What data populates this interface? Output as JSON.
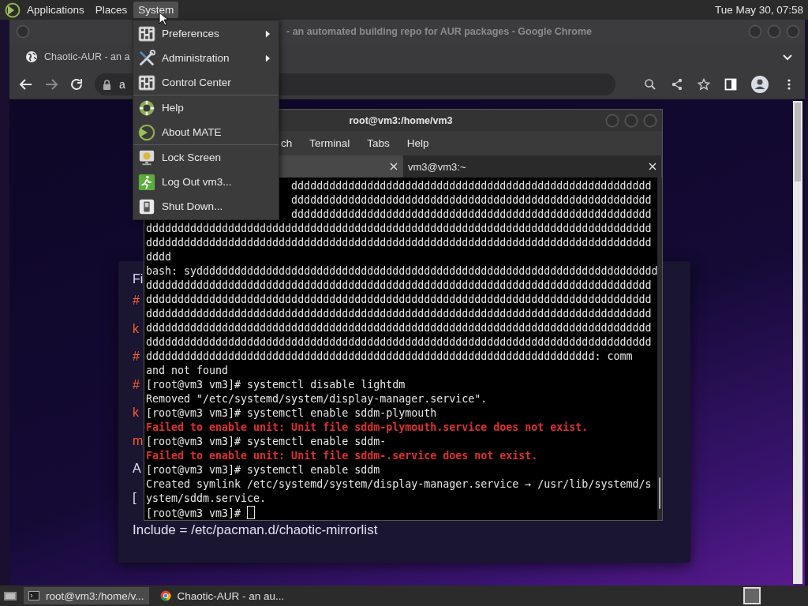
{
  "top_panel": {
    "menus": [
      {
        "label": "Applications",
        "selected": false
      },
      {
        "label": "Places",
        "selected": false
      },
      {
        "label": "System",
        "selected": true
      }
    ],
    "clock": "Tue May 30, 07:58"
  },
  "system_menu": {
    "items": [
      {
        "label": "Preferences",
        "kind": "preferences",
        "submenu": true,
        "separator_after": false
      },
      {
        "label": "Administration",
        "kind": "tools",
        "submenu": true,
        "separator_after": false
      },
      {
        "label": "Control Center",
        "kind": "preferences",
        "submenu": false,
        "separator_after": true
      },
      {
        "label": "Help",
        "kind": "help",
        "submenu": false,
        "separator_after": false
      },
      {
        "label": "About MATE",
        "kind": "about",
        "submenu": false,
        "separator_after": true
      },
      {
        "label": "Lock Screen",
        "kind": "lock",
        "submenu": false,
        "separator_after": false
      },
      {
        "label": "Log Out vm3...",
        "kind": "logout",
        "submenu": false,
        "separator_after": false
      },
      {
        "label": "Shut Down...",
        "kind": "shutdown",
        "submenu": false,
        "separator_after": false
      }
    ]
  },
  "browser": {
    "title": "- an automated building repo for AUR packages - Google Chrome",
    "tab": "Chaotic-AUR - an a",
    "address": "a",
    "page_fragments": [
      {
        "text": "Fi",
        "kind": "plain"
      },
      {
        "text": "#",
        "kind": "comment"
      },
      {
        "text": "k",
        "kind": "comment"
      },
      {
        "text": "#",
        "kind": "comment"
      },
      {
        "text": "#",
        "kind": "comment"
      },
      {
        "text": "k",
        "kind": "comment"
      },
      {
        "text": "m",
        "kind": "comment"
      },
      {
        "text": "A",
        "kind": "plain"
      },
      {
        "text": "[",
        "kind": "code"
      },
      {
        "text": "Include = /etc/pacman.d/chaotic-mirrorlist",
        "kind": "code"
      }
    ]
  },
  "terminal": {
    "title": "root@vm3:/home/vm3",
    "menus": [
      "ch",
      "Terminal",
      "Tabs",
      "Help"
    ],
    "tabs": [
      {
        "selected": true
      },
      {
        "label": "vm3@vm3:~",
        "selected": false
      }
    ],
    "lines": [
      {
        "kind": "covered",
        "text": "ddddddddddddddddddddddddddddddddddddddddddddddddddddddddd"
      },
      {
        "kind": "covered",
        "text": "ddddddddddddddddddddddddddddddddddddddddddddddddddddddddd"
      },
      {
        "kind": "covered",
        "text": "ddddddddddddddddddddddddddddddddddddddddddddddddddddddddd"
      },
      {
        "kind": "output",
        "text": "dddddddddddddddddddddddddddddddddddddddddddddddddddddddddddddddddddddddddddddddd"
      },
      {
        "kind": "output",
        "text": "dddddddddddddddddddddddddddddddddddddddddddddddddddddddddddddddddddddddddddddddd"
      },
      {
        "kind": "output",
        "text": "dddd"
      },
      {
        "kind": "output",
        "text": "bash: syddddddddddddddddddddddddddddddddddddddddddddddddddddddddddddddddddddddddd"
      },
      {
        "kind": "output",
        "text": "dddddddddddddddddddddddddddddddddddddddddddddddddddddddddddddddddddddddddddddddd"
      },
      {
        "kind": "output",
        "text": "dddddddddddddddddddddddddddddddddddddddddddddddddddddddddddddddddddddddddddddddd"
      },
      {
        "kind": "output",
        "text": "dddddddddddddddddddddddddddddddddddddddddddddddddddddddddddddddddddddddddddddddd"
      },
      {
        "kind": "output",
        "text": "dddddddddddddddddddddddddddddddddddddddddddddddddddddddddddddddddddddddddddddddd"
      },
      {
        "kind": "output",
        "text": "dddddddddddddddddddddddddddddddddddddddddddddddddddddddddddddddddddddddddddddddd"
      },
      {
        "kind": "output",
        "text": "ddddddddddddddddddddddddddddddddddddddddddddddddddddddddddddddddddddddd: comm"
      },
      {
        "kind": "output",
        "text": "and not found"
      },
      {
        "kind": "output",
        "text": "[root@vm3 vm3]# systemctl disable lightdm"
      },
      {
        "kind": "output",
        "text": "Removed \"/etc/systemd/system/display-manager.service\"."
      },
      {
        "kind": "output",
        "text": "[root@vm3 vm3]# systemctl enable sddm-plymouth"
      },
      {
        "kind": "error",
        "text": "Failed to enable unit: Unit file sddm-plymouth.service does not exist."
      },
      {
        "kind": "output",
        "text": "[root@vm3 vm3]# systemctl enable sddm-"
      },
      {
        "kind": "error",
        "text": "Failed to enable unit: Unit file sddm-.service does not exist."
      },
      {
        "kind": "output",
        "text": "[root@vm3 vm3]# systemctl enable sddm"
      },
      {
        "kind": "output",
        "text": "Created symlink /etc/systemd/system/display-manager.service → /usr/lib/systemd/s"
      },
      {
        "kind": "output",
        "text": "ystem/sddm.service."
      },
      {
        "kind": "prompt",
        "text": "[root@vm3 vm3]#"
      }
    ]
  },
  "taskbar": {
    "tasks": [
      {
        "label": "root@vm3:/home/v...",
        "kind": "terminal",
        "selected": true
      },
      {
        "label": "Chaotic-AUR - an au...",
        "kind": "browser",
        "selected": false
      }
    ]
  }
}
